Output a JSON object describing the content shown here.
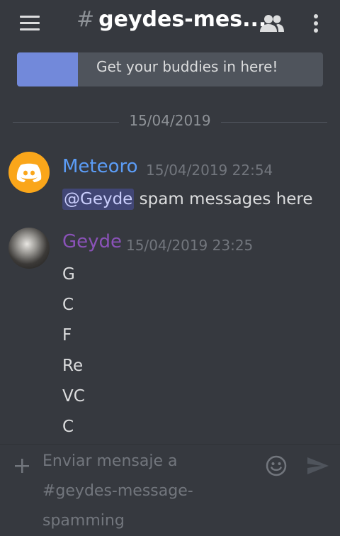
{
  "header": {
    "hash": "#",
    "channel_name": "geydes-mes..."
  },
  "banner": {
    "text": "Get your buddies in here!"
  },
  "date_divider": "15/04/2019",
  "messages": [
    {
      "author": "Meteoro",
      "author_color": "#5b9cf6",
      "timestamp": "15/04/2019 22:54",
      "mention": "@Geyde",
      "text": " spam messages here"
    },
    {
      "author": "Geyde",
      "author_color": "#8a52b8",
      "timestamp": "15/04/2019 23:25",
      "lines": [
        "G",
        "C",
        "F",
        "Re",
        "VC",
        "C"
      ]
    }
  ],
  "composer": {
    "placeholder_line1": "Enviar mensaje a",
    "placeholder_line2": "#geydes-message-",
    "placeholder_line3": "spamming"
  },
  "icons": {
    "menu": "hamburger-icon",
    "members": "members-icon",
    "more": "more-vertical-icon",
    "attach": "plus-icon",
    "emoji": "emoji-icon",
    "send": "send-icon",
    "avatar_bot": "discord-logo-icon"
  },
  "colors": {
    "background": "#36393f",
    "blurple": "#7289da",
    "avatar_orange": "#faa61a"
  }
}
